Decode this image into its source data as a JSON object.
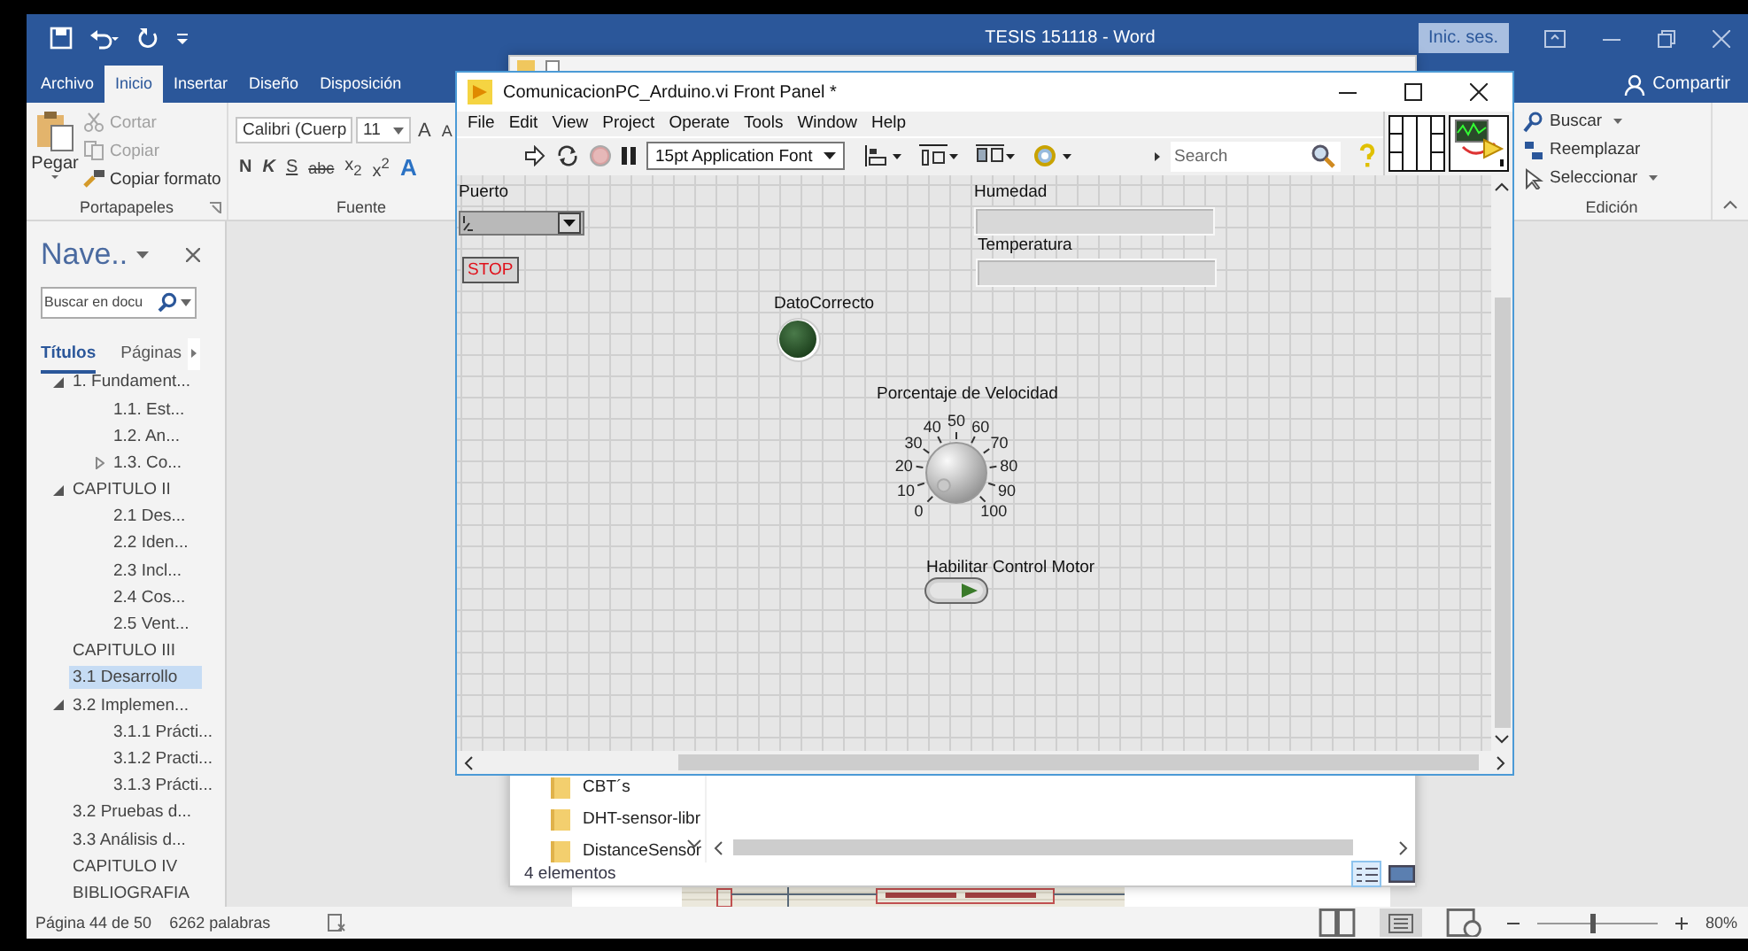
{
  "word": {
    "title": "TESIS 151118  -  Word",
    "sign_in": "Inic. ses.",
    "share": "Compartir",
    "tabs": [
      {
        "label": "Archivo",
        "selected": false
      },
      {
        "label": "Inicio",
        "selected": true
      },
      {
        "label": "Insertar",
        "selected": false
      },
      {
        "label": "Diseño",
        "selected": false
      },
      {
        "label": "Disposición",
        "selected": false
      }
    ],
    "clipboard": {
      "paste": "Pegar",
      "actions": [
        {
          "label": "Cortar",
          "disabled": true
        },
        {
          "label": "Copiar",
          "disabled": true
        },
        {
          "label": "Copiar formato",
          "disabled": false
        }
      ],
      "group": "Portapapeles"
    },
    "font": {
      "name": "Calibri (Cuerp",
      "size": "11",
      "size_buttons": [
        "A",
        "A"
      ],
      "styles": [
        "N",
        "K",
        "S",
        "abc",
        "x$_{2}$",
        "x$^{2}$"
      ],
      "effects": "A",
      "group": "Fuente"
    },
    "editing": {
      "actions": [
        {
          "label": "Buscar",
          "menu": true
        },
        {
          "label": "Reemplazar",
          "menu": false
        },
        {
          "label": "Seleccionar",
          "menu": true
        }
      ],
      "group": "Edición"
    },
    "nav": {
      "title": "Nave..",
      "search_placeholder": "Buscar en docu",
      "tabs": [
        {
          "label": "Títulos",
          "selected": true
        },
        {
          "label": "Páginas",
          "selected": false
        }
      ],
      "items": [
        {
          "label": "1. Fundament...",
          "selected": false,
          "expanded": true,
          "children": [
            {
              "label": "1.1. Est...",
              "selected": false
            },
            {
              "label": "1.2.  An...",
              "selected": false
            },
            {
              "label": "1.3. Co...",
              "selected": false,
              "expanded": false
            }
          ]
        },
        {
          "label": "CAPITULO II",
          "selected": false,
          "expanded": true,
          "children": [
            {
              "label": "2.1 Des...",
              "selected": false
            },
            {
              "label": "2.2 Iden...",
              "selected": false
            },
            {
              "label": "2.3 Incl...",
              "selected": false
            },
            {
              "label": "2.4 Cos...",
              "selected": false
            },
            {
              "label": "2.5 Vent...",
              "selected": false
            }
          ]
        },
        {
          "label": "CAPITULO III",
          "selected": false
        },
        {
          "label": "3.1 Desarrollo",
          "selected": true
        },
        {
          "label": "3.2 Implemen...",
          "selected": false,
          "expanded": true,
          "children": [
            {
              "label": "3.1.1 Prácti...",
              "selected": false
            },
            {
              "label": "3.1.2 Practi...",
              "selected": false
            },
            {
              "label": "3.1.3 Prácti...",
              "selected": false
            }
          ]
        },
        {
          "label": "3.2 Pruebas d...",
          "selected": false
        },
        {
          "label": "3.3 Análisis d...",
          "selected": false
        },
        {
          "label": "CAPITULO IV",
          "selected": false
        },
        {
          "label": "BIBLIOGRAFIA",
          "selected": false
        }
      ]
    },
    "status_bar": {
      "page": "Página 44 de 50",
      "words": "6262 palabras",
      "zoom_slider": {
        "level": 0.45
      },
      "zoom": "80%"
    }
  },
  "explorer": {
    "folders": [
      "CBT´s",
      "DHT-sensor-libr",
      "DistanceSensor"
    ],
    "status": "4 elementos"
  },
  "labview": {
    "title": "ComunicacionPC_Arduino.vi Front Panel *",
    "menu": [
      "File",
      "Edit",
      "View",
      "Project",
      "Operate",
      "Tools",
      "Window",
      "Help"
    ],
    "font": "15pt Application Font",
    "search_placeholder": "Search",
    "controls": [
      {
        "kind": "ring",
        "label": "Puerto"
      },
      {
        "kind": "stop_button",
        "label": "STOP"
      },
      {
        "kind": "string_indicator",
        "label": "Humedad"
      },
      {
        "kind": "string_indicator",
        "label": "Temperatura"
      },
      {
        "kind": "led",
        "label": "DatoCorrecto",
        "on": false
      },
      {
        "kind": "knob",
        "label": "Porcentaje de Velocidad",
        "scale": [
          "50",
          "40",
          "60",
          "30",
          "70",
          "20",
          "80",
          "10",
          "90",
          "0",
          "100"
        ]
      },
      {
        "kind": "toggle",
        "label": "Habilitar Control Motor",
        "on": false
      }
    ]
  }
}
